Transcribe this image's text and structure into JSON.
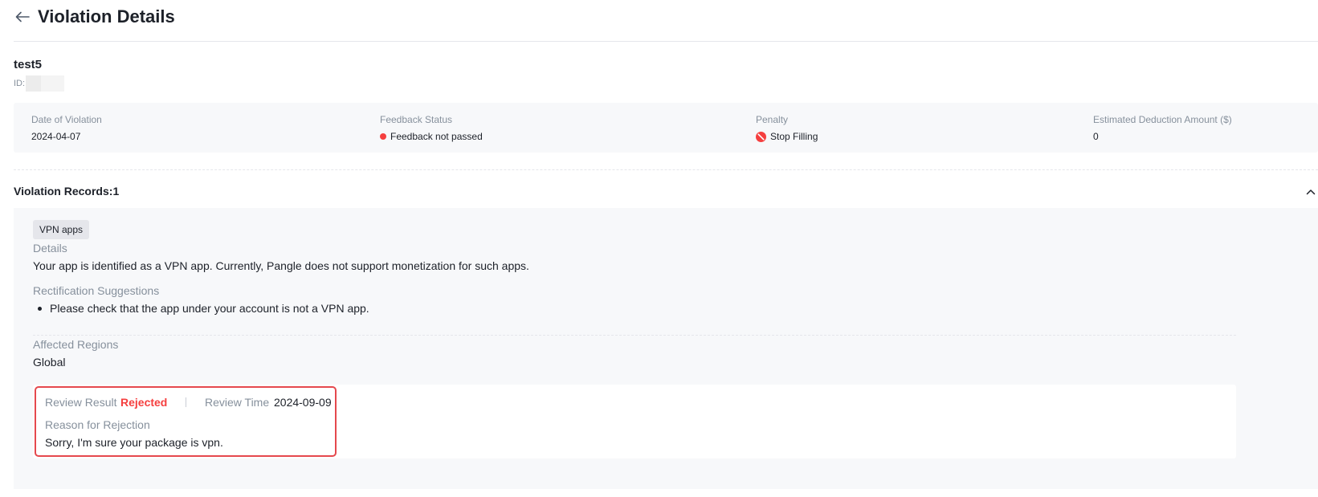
{
  "header": {
    "title": "Violation Details"
  },
  "app": {
    "name": "test5",
    "id_label": "ID:"
  },
  "summary": {
    "date_label": "Date of Violation",
    "date_value": "2024-04-07",
    "feedback_label": "Feedback Status",
    "feedback_value": "Feedback not passed",
    "penalty_label": "Penalty",
    "penalty_value": "Stop Filling",
    "deduction_label": "Estimated Deduction Amount ($)",
    "deduction_value": "0"
  },
  "records": {
    "title": "Violation Records:",
    "count": "1",
    "items": [
      {
        "tag": "VPN apps",
        "details_label": "Details",
        "details_text": "Your app is identified as a VPN app. Currently, Pangle does not support monetization for such apps.",
        "suggestions_label": "Rectification Suggestions",
        "suggestions": [
          "Please check that the app under your account is not a VPN app."
        ],
        "regions_label": "Affected Regions",
        "regions_value": "Global",
        "review": {
          "result_label": "Review Result",
          "result_value": "Rejected",
          "time_label": "Review Time",
          "time_value": "2024-09-09",
          "reason_label": "Reason for Rejection",
          "reason_text": "Sorry, I'm sure your package is vpn."
        }
      }
    ]
  },
  "colors": {
    "status_red": "#f53f3f",
    "highlight_border": "#e5484d",
    "muted_text": "#86909c",
    "panel_bg": "#f7f8fa"
  },
  "icons": {
    "back": "arrow-left-icon",
    "collapse": "chevron-up-icon",
    "penalty": "ban-icon"
  }
}
